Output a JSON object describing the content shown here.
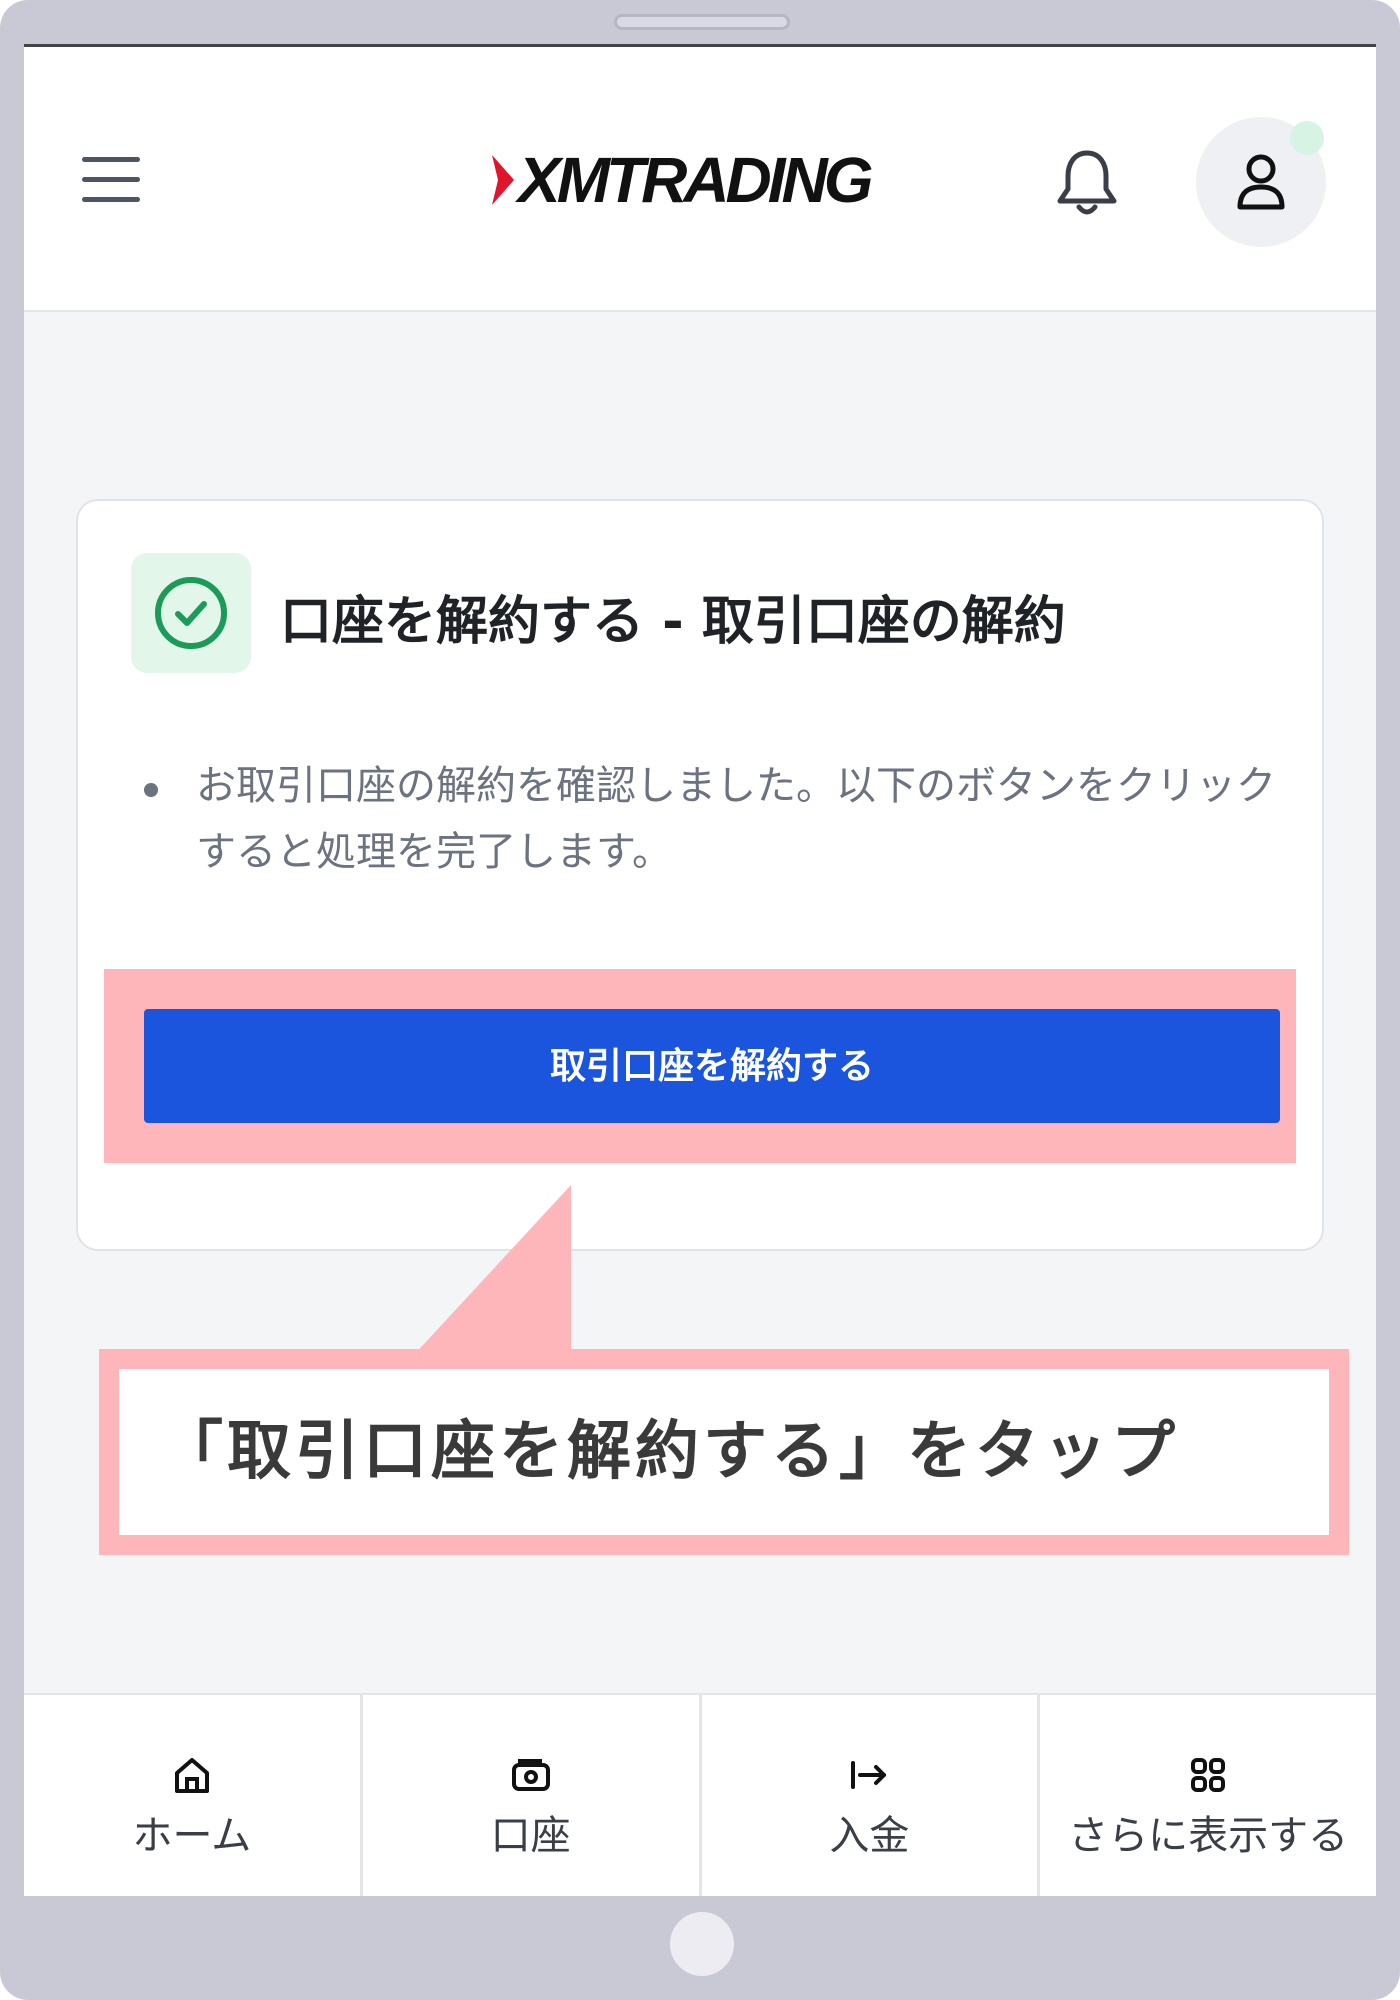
{
  "header": {
    "logo_text": "XMTRADING",
    "menu_icon": "hamburger-menu-icon",
    "notification_icon": "bell-icon",
    "profile_icon": "user-icon"
  },
  "card": {
    "title": "口座を解約する - 取引口座の解約",
    "status_icon": "check-circle-icon",
    "bullet_text": "お取引口座の解約を確認しました。以下のボタンをクリックすると処理を完了します。",
    "button_label": "取引口座を解約する"
  },
  "callout": {
    "text": "「取引口座を解約する」をタップ"
  },
  "bottom_nav": {
    "items": [
      {
        "label": "ホーム",
        "icon": "home-icon"
      },
      {
        "label": "口座",
        "icon": "wallet-icon"
      },
      {
        "label": "入金",
        "icon": "deposit-arrow-icon"
      },
      {
        "label": "さらに表示する",
        "icon": "grid-icon"
      }
    ]
  },
  "colors": {
    "primary_button": "#1b55de",
    "highlight": "#ffb6bb",
    "success_bg": "#e2f6ea",
    "success": "#1a9b57",
    "logo_red": "#e0142a"
  }
}
